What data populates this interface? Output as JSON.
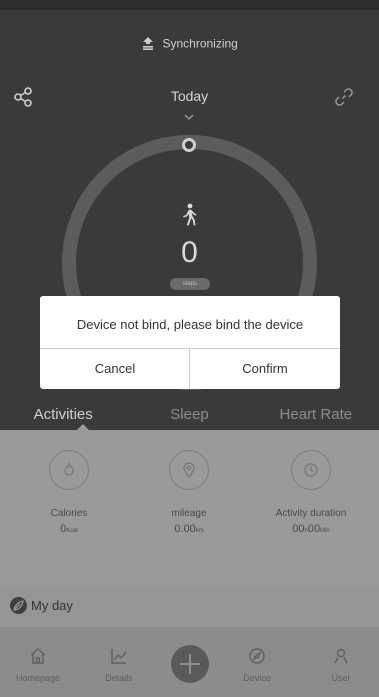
{
  "header": {
    "sync_text": "Synchronizing",
    "date_label": "Today"
  },
  "ring": {
    "steps_value": "0",
    "steps_unit": "steps"
  },
  "tabs": [
    {
      "label": "Activities",
      "active": true
    },
    {
      "label": "Sleep",
      "active": false
    },
    {
      "label": "Heart Rate",
      "active": false
    }
  ],
  "stats": [
    {
      "label": "Calories",
      "value": "0",
      "unit": "Kcal",
      "icon": "fire-icon"
    },
    {
      "label": "mileage",
      "value": "0.00",
      "unit": "km",
      "icon": "location-pin-icon"
    },
    {
      "label": "Activity duration",
      "value_h": "00",
      "unit_h": "h",
      "value_m": "00",
      "unit_m": "Min",
      "icon": "clock-icon"
    }
  ],
  "myday": {
    "label": "My day"
  },
  "nav": [
    {
      "label": "Homepage",
      "icon": "home-icon"
    },
    {
      "label": "Details",
      "icon": "chart-icon"
    },
    {
      "label": "Device",
      "icon": "compass-icon"
    },
    {
      "label": "User",
      "icon": "user-icon"
    }
  ],
  "dialog": {
    "message": "Device not bind, please bind the device",
    "cancel_label": "Cancel",
    "confirm_label": "Confirm"
  },
  "colors": {
    "top_bg": "#3a3a3a",
    "stats_bg": "#9a9a9a",
    "nav_bg": "#8c8c8c",
    "dialog_bg": "#ffffff"
  }
}
